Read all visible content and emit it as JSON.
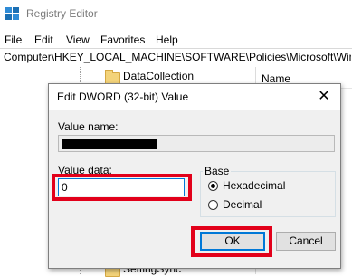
{
  "window": {
    "title": "Registry Editor",
    "icon": "registry-editor-icon"
  },
  "menu": [
    "File",
    "Edit",
    "View",
    "Favorites",
    "Help"
  ],
  "address": "Computer\\HKEY_LOCAL_MACHINE\\SOFTWARE\\Policies\\Microsoft\\Windo",
  "tree": {
    "top_item": "DataCollection",
    "bottom_item": "SettingSync"
  },
  "list": {
    "column_name": "Name"
  },
  "dialog": {
    "title": "Edit DWORD (32-bit) Value",
    "close_glyph": "✕",
    "value_name_label": "Value name:",
    "value_data_label": "Value data:",
    "value_data": "0",
    "base_label": "Base",
    "base_options": [
      {
        "label": "Hexadecimal",
        "checked": true
      },
      {
        "label": "Decimal",
        "checked": false
      }
    ],
    "ok_label": "OK",
    "cancel_label": "Cancel"
  },
  "colors": {
    "highlight": "#e2001a",
    "focus": "#0078d7",
    "dialog_bg": "#f0f0f0"
  }
}
